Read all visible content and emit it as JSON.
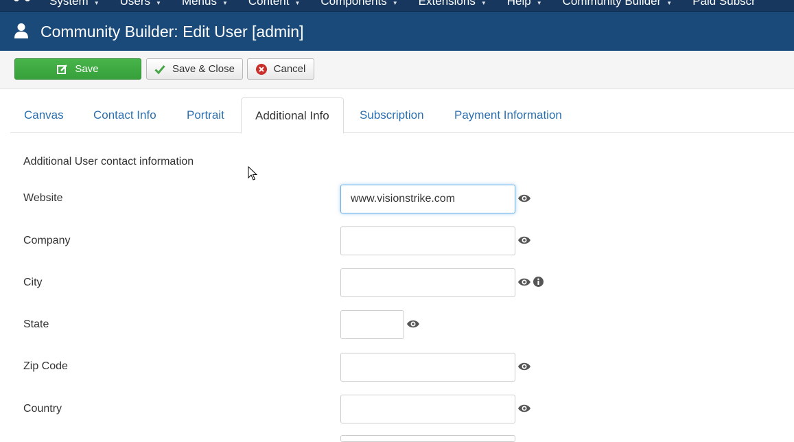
{
  "topnav": {
    "items": [
      "System",
      "Users",
      "Menus",
      "Content",
      "Components",
      "Extensions",
      "Help",
      "Community Builder",
      "Paid Subscr"
    ]
  },
  "header": {
    "title": "Community Builder: Edit User [admin]",
    "icon": "user-icon"
  },
  "toolbar": {
    "save_label": "Save",
    "save_close_label": "Save & Close",
    "cancel_label": "Cancel"
  },
  "tabs": [
    "Canvas",
    "Contact Info",
    "Portrait",
    "Additional Info",
    "Subscription",
    "Payment Information"
  ],
  "active_tab": "Additional Info",
  "form": {
    "section_title": "Additional User contact information",
    "fields": [
      {
        "label": "Website",
        "value": "www.visionstrike.com"
      },
      {
        "label": "Company",
        "value": ""
      },
      {
        "label": "City",
        "value": ""
      },
      {
        "label": "State",
        "value": ""
      },
      {
        "label": "Zip Code",
        "value": ""
      },
      {
        "label": "Country",
        "value": ""
      }
    ]
  },
  "colors": {
    "header": "#1a4a7a",
    "topnav": "#17375e",
    "save": "#47b44a",
    "link": "#2a6fb0"
  }
}
